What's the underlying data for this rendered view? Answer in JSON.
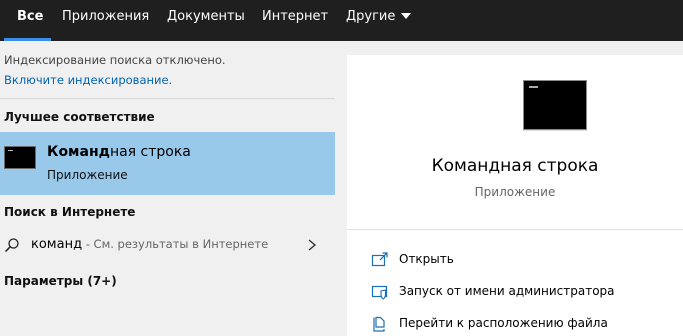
{
  "tabs": [
    {
      "label": "Все",
      "active": true
    },
    {
      "label": "Приложения"
    },
    {
      "label": "Документы"
    },
    {
      "label": "Интернет"
    },
    {
      "label": "Другие"
    }
  ],
  "accent_color": "#3b8eea",
  "left": {
    "notice": "Индексирование поиска отключено.",
    "notice_link": "Включите индексирование.",
    "best_match_heading": "Лучшее соответствие",
    "best_match": {
      "title_bold": "Команд",
      "title_rest": "ная строка",
      "subtitle": "Приложение",
      "icon": "command-prompt-icon"
    },
    "web_heading": "Поиск в Интернете",
    "web_query": "команд",
    "web_hint": " - См. результаты в Интернете",
    "params": "Параметры (7+)"
  },
  "right": {
    "title": "Командная строка",
    "subtitle": "Приложение",
    "actions": [
      {
        "label": "Открыть",
        "icon": "open-icon"
      },
      {
        "label": "Запуск от имени администратора",
        "icon": "shield-admin-icon"
      },
      {
        "label": "Перейти к расположению файла",
        "icon": "file-location-icon"
      }
    ]
  }
}
